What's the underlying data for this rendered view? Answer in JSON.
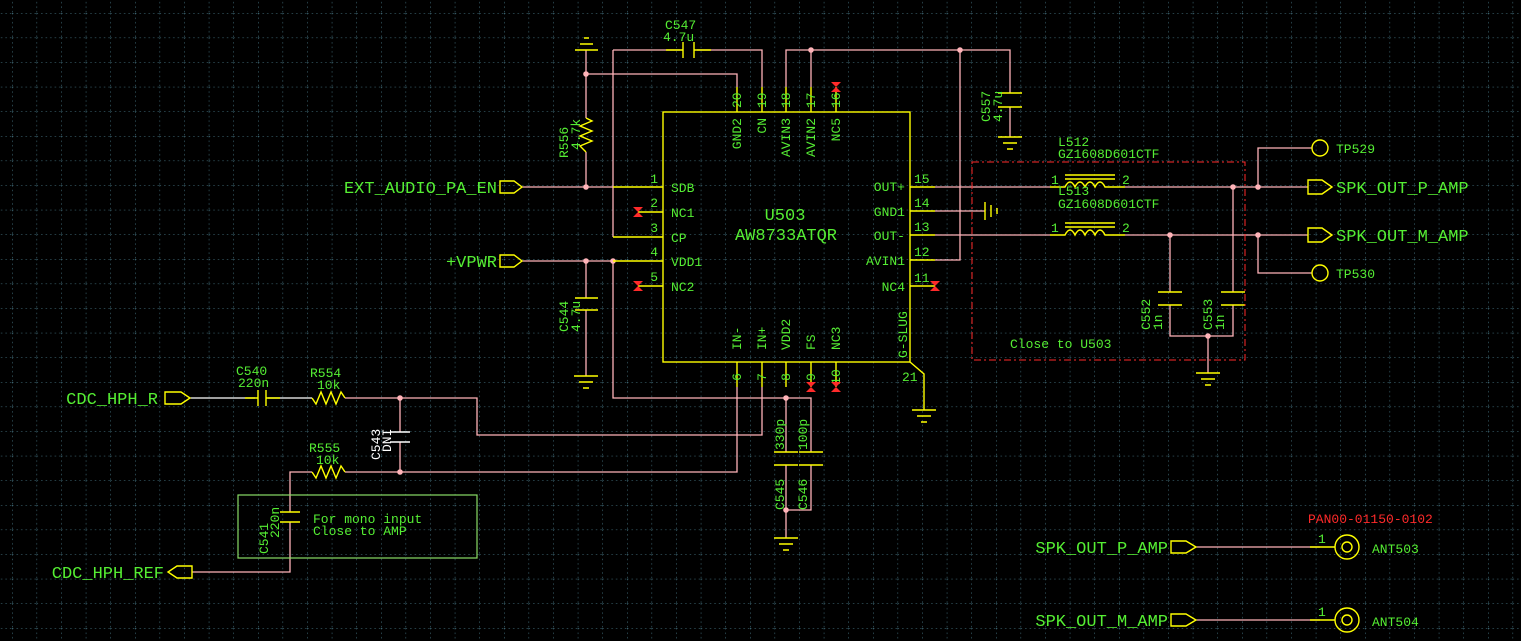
{
  "colors": {
    "background": "#000000",
    "grid": "#4f8494",
    "wire": "#ffb3b8",
    "component": "#ffff00",
    "text": "#55ee33",
    "no_connect": "#ff2a2a",
    "keepout": "#ff2a2a",
    "note_box": "#88dd66"
  },
  "ic": {
    "ref": "U503",
    "part": "AW8733ATQR",
    "left_pins": [
      {
        "num": "1",
        "name": "SDB"
      },
      {
        "num": "2",
        "name": "NC1"
      },
      {
        "num": "3",
        "name": "CP"
      },
      {
        "num": "4",
        "name": "VDD1"
      },
      {
        "num": "5",
        "name": "NC2"
      }
    ],
    "top_pins": [
      {
        "num": "20",
        "name": "GND2"
      },
      {
        "num": "19",
        "name": "CN"
      },
      {
        "num": "18",
        "name": "AVIN3"
      },
      {
        "num": "17",
        "name": "AVIN2"
      },
      {
        "num": "16",
        "name": "NC5"
      }
    ],
    "right_pins": [
      {
        "num": "15",
        "name": "OUT+"
      },
      {
        "num": "14",
        "name": "GND1"
      },
      {
        "num": "13",
        "name": "OUT-"
      },
      {
        "num": "12",
        "name": "AVIN1"
      },
      {
        "num": "11",
        "name": "NC4"
      }
    ],
    "bottom_pins": [
      {
        "num": "6",
        "name": "IN-"
      },
      {
        "num": "7",
        "name": "IN+"
      },
      {
        "num": "8",
        "name": "VDD2"
      },
      {
        "num": "9",
        "name": "FS"
      },
      {
        "num": "10",
        "name": "NC3"
      }
    ],
    "slug_pin": {
      "num": "21",
      "name": "G-SLUG"
    }
  },
  "ports": {
    "ext_audio_pa_en": "EXT_AUDIO_PA_EN",
    "vpwr": "+VPWR",
    "cdc_hph_r": "CDC_HPH_R",
    "cdc_hph_ref": "CDC_HPH_REF",
    "spk_out_p": "SPK_OUT_P_AMP",
    "spk_out_m": "SPK_OUT_M_AMP",
    "spk_out_p2": "SPK_OUT_P_AMP",
    "spk_out_m2": "SPK_OUT_M_AMP"
  },
  "components": {
    "c547": {
      "ref": "C547",
      "value": "4.7u"
    },
    "r556": {
      "ref": "R556",
      "value": "4.7k"
    },
    "c544": {
      "ref": "C544",
      "value": "4.7u"
    },
    "c557": {
      "ref": "C557",
      "value": "4.7u"
    },
    "l512": {
      "ref": "L512",
      "value": "GZ1608D601CTF",
      "pin1": "1",
      "pin2": "2"
    },
    "l513": {
      "ref": "L513",
      "value": "GZ1608D601CTF",
      "pin1": "1",
      "pin2": "2"
    },
    "c552": {
      "ref": "C552",
      "value": "1n"
    },
    "c553": {
      "ref": "C553",
      "value": "1n"
    },
    "tp529": {
      "ref": "TP529"
    },
    "tp530": {
      "ref": "TP530"
    },
    "c540": {
      "ref": "C540",
      "value": "220n"
    },
    "r554": {
      "ref": "R554",
      "value": "10k"
    },
    "r555": {
      "ref": "R555",
      "value": "10k"
    },
    "c543": {
      "ref": "C543",
      "value": "DNI"
    },
    "c541": {
      "ref": "C541",
      "value": "220n"
    },
    "c545": {
      "ref": "C545",
      "value": "330p"
    },
    "c546": {
      "ref": "C546",
      "value": "100p"
    },
    "ant503": {
      "ref": "ANT503",
      "pin": "1",
      "part": "PAN00-01150-0102"
    },
    "ant504": {
      "ref": "ANT504",
      "pin": "1"
    }
  },
  "notes": {
    "close_to_u503": "Close to U503",
    "mono_line1": "For mono input",
    "mono_line2": "Close to AMP"
  }
}
